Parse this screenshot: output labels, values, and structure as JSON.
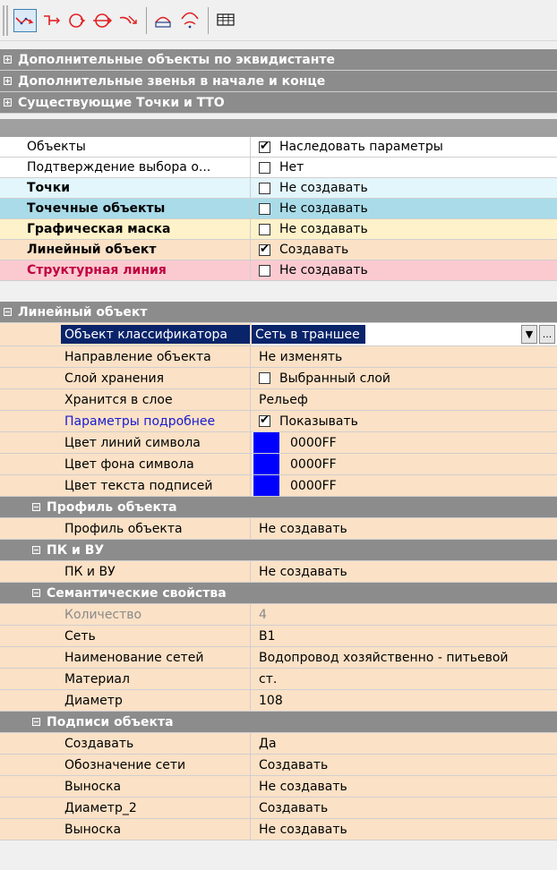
{
  "toolbar": {
    "buttons": [
      {
        "name": "polyline-tool-icon",
        "active": true
      },
      {
        "name": "branch-line-tool-icon"
      },
      {
        "name": "circle-arrow-tool-icon"
      },
      {
        "name": "circle-double-arrow-tool-icon"
      },
      {
        "name": "curve-arrow-tool-icon"
      },
      {
        "name": "arc-rect-tool-icon"
      },
      {
        "name": "arc-points-tool-icon"
      },
      {
        "name": "table-grid-icon"
      }
    ]
  },
  "groups_top": [
    {
      "label": "Дополнительные объекты по эквидистанте"
    },
    {
      "label": "Дополнительные звенья в начале и конце"
    },
    {
      "label": "Существующие Точки и ТТО"
    }
  ],
  "props_top": [
    {
      "label": "Объекты",
      "value": "Наследовать параметры",
      "check": true,
      "bg": "#ffffff",
      "bold": false
    },
    {
      "label": "Подтверждение выбора о...",
      "value": "Нет",
      "check": false,
      "bg": "#ffffff",
      "bold": false
    },
    {
      "label": "Точки",
      "value": "Не создавать",
      "check": false,
      "bg": "#e2f6fb",
      "bold": true
    },
    {
      "label": "Точечные объекты",
      "value": "Не создавать",
      "check": false,
      "bg": "#a9dbe9",
      "bold": true
    },
    {
      "label": "Графическая маска",
      "value": "Не создавать",
      "check": false,
      "bg": "#fdf2c9",
      "bold": true
    },
    {
      "label": "Линейный объект",
      "value": "Создавать",
      "check": true,
      "bg": "#fbe1c6",
      "bold": true
    },
    {
      "label": "Структурная линия",
      "value": "Не создавать",
      "check": false,
      "bg": "#fbcad0",
      "bold": true,
      "color": "#c00040"
    }
  ],
  "linear_group": {
    "label": "Линейный объект"
  },
  "linear_props": {
    "classifier": {
      "label": "Объект классификатора",
      "value": "Сеть в траншее",
      "btn1": "▼",
      "btn2": "..."
    },
    "direction": {
      "label": "Направление объекта",
      "value": "Не изменять"
    },
    "layer": {
      "label": "Слой хранения",
      "value": "Выбранный слой"
    },
    "stored": {
      "label": "Хранится в слое",
      "value": "Рельеф"
    },
    "more": {
      "label": "Параметры подробнее",
      "value": "Показывать"
    },
    "line_color": {
      "label": "Цвет линий символа",
      "value": "0000FF"
    },
    "bg_color": {
      "label": "Цвет фона символа",
      "value": "0000FF"
    },
    "text_color": {
      "label": "Цвет текста подписей",
      "value": "0000FF"
    }
  },
  "profile_group": {
    "label": "Профиль объекта"
  },
  "profile": {
    "label": "Профиль объекта",
    "value": "Не создавать"
  },
  "pk_group": {
    "label": "ПК и ВУ"
  },
  "pk": {
    "label": "ПК и ВУ",
    "value": "Не создавать"
  },
  "sem_group": {
    "label": "Семантические свойства"
  },
  "sem": [
    {
      "label": "Количество",
      "value": "4",
      "disabled": true
    },
    {
      "label": "Сеть",
      "value": "B1"
    },
    {
      "label": "Наименование сетей",
      "value": "Водопровод хозяйственно - питьевой"
    },
    {
      "label": "Материал",
      "value": "ст."
    },
    {
      "label": "Диаметр",
      "value": "108"
    }
  ],
  "labels_group": {
    "label": "Подписи объекта"
  },
  "labels": [
    {
      "label": "Создавать",
      "value": "Да"
    },
    {
      "label": "Обозначение сети",
      "value": "Создавать"
    },
    {
      "label": "Выноска",
      "value": "Не создавать"
    },
    {
      "label": "Диаметр_2",
      "value": "Создавать"
    },
    {
      "label": "Выноска",
      "value": "Не создавать"
    }
  ],
  "colors": {
    "peach": "#fbe1c6",
    "group_gray": "#8c8c8c",
    "swatch": "#0000ff",
    "select": "#0a246a",
    "link_blue": "#1a1ad0"
  }
}
